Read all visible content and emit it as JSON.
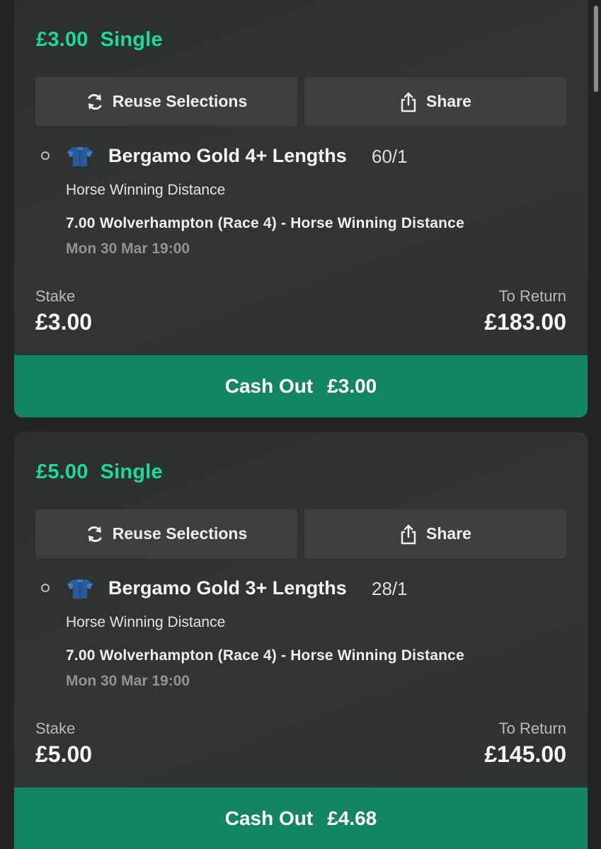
{
  "bets": [
    {
      "stake_header": "£3.00",
      "bet_type": "Single",
      "reuse_label": "Reuse Selections",
      "share_label": "Share",
      "selection_name": "Bergamo Gold 4+ Lengths",
      "odds": "60/1",
      "market": "Horse Winning Distance",
      "event": "7.00 Wolverhampton (Race 4) - Horse Winning Distance",
      "event_time": "Mon 30 Mar 19:00",
      "stake_label": "Stake",
      "stake_value": "£3.00",
      "return_label": "To Return",
      "return_value": "£183.00",
      "cashout_label": "Cash Out",
      "cashout_value": "£3.00"
    },
    {
      "stake_header": "£5.00",
      "bet_type": "Single",
      "reuse_label": "Reuse Selections",
      "share_label": "Share",
      "selection_name": "Bergamo Gold 3+ Lengths",
      "odds": "28/1",
      "market": "Horse Winning Distance",
      "event": "7.00 Wolverhampton (Race 4) - Horse Winning Distance",
      "event_time": "Mon 30 Mar 19:00",
      "stake_label": "Stake",
      "stake_value": "£5.00",
      "return_label": "To Return",
      "return_value": "£145.00",
      "cashout_label": "Cash Out",
      "cashout_value": "£4.68"
    }
  ],
  "icons": {
    "reuse": "refresh-icon",
    "share": "share-icon",
    "silk": "jockey-silk-icon",
    "radio": "selection-status-icon"
  },
  "colors": {
    "accent_green": "#1fd99a",
    "cashout_bg": "#148562",
    "card_bg": "#2e3333",
    "button_bg": "#3c4140"
  }
}
